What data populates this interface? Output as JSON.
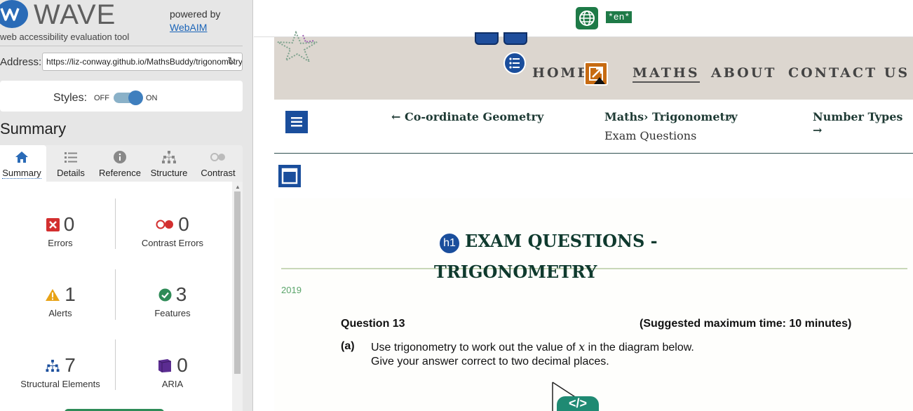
{
  "wave": {
    "logo_text": "WAVE",
    "tagline": "web accessibility evaluation tool",
    "powered_by": "powered by",
    "webaim_link": "WebAIM",
    "address_label": "Address:",
    "address_value": "https://liz-conway.github.io/MathsBuddy/trigonometry",
    "styles_label": "Styles:",
    "styles_off": "OFF",
    "styles_on": "ON",
    "styles_enabled": true,
    "summary_heading": "Summary",
    "tabs": [
      {
        "label": "Summary",
        "icon": "home-icon",
        "active": true
      },
      {
        "label": "Details",
        "icon": "list-icon",
        "active": false
      },
      {
        "label": "Reference",
        "icon": "info-icon",
        "active": false
      },
      {
        "label": "Structure",
        "icon": "structure-icon",
        "active": false
      },
      {
        "label": "Contrast",
        "icon": "contrast-icon",
        "active": false
      }
    ],
    "stats": [
      {
        "key": "errors",
        "count": "0",
        "label": "Errors",
        "icon": "error-icon",
        "color": "#d32f2f"
      },
      {
        "key": "contrast_errors",
        "count": "0",
        "label": "Contrast Errors",
        "icon": "contrast-error-icon",
        "color": "#d32f2f"
      },
      {
        "key": "alerts",
        "count": "1",
        "label": "Alerts",
        "icon": "alert-icon",
        "color": "#e8a317"
      },
      {
        "key": "features",
        "count": "3",
        "label": "Features",
        "icon": "feature-icon",
        "color": "#2e8b57"
      },
      {
        "key": "structural",
        "count": "7",
        "label": "Structural Elements",
        "icon": "structure-icon",
        "color": "#1a4e9c"
      },
      {
        "key": "aria",
        "count": "0",
        "label": "ARIA",
        "icon": "aria-icon",
        "color": "#5b2c91"
      }
    ]
  },
  "page": {
    "lang_badge": "*en*",
    "nav": {
      "home": "HOME",
      "maths": "MATHS",
      "about": "ABOUT",
      "contact": "CONTACT US"
    },
    "prev_link": "← Co-ordinate Geometry",
    "next_link": "Number Types →",
    "breadcrumb_1": "Maths",
    "breadcrumb_2": "› Trigonometry",
    "breadcrumb_3": "›",
    "breadcrumb_sub": "Exam Questions",
    "h1_badge": "h1",
    "title_line1": "EXAM QUESTIONS -",
    "title_line2": "TRIGONOMETRY",
    "year": "2019",
    "question_title": "Question 13",
    "question_time": "(Suggested maximum time: 10 minutes)",
    "part_label": "(a)",
    "part_line1": "Use trigonometry to work out the value of",
    "part_var": "x",
    "part_line1_end": "in the diagram below.",
    "part_line2": "Give your answer correct to two decimal places.",
    "code_badge": "</>"
  },
  "colors": {
    "wave_blue": "#2a6bb7",
    "page_green": "#1e7a47",
    "heading_green": "#0f3a2e"
  }
}
